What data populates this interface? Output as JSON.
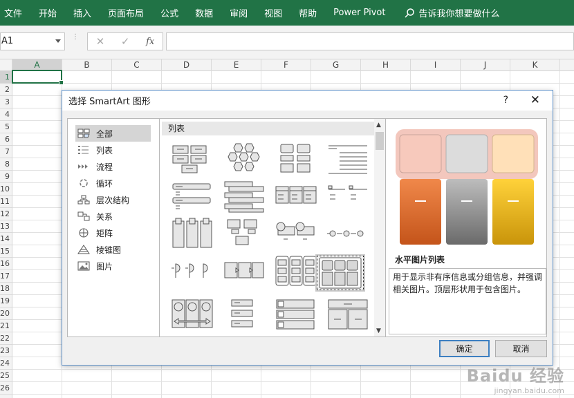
{
  "ribbon": {
    "tabs": [
      "文件",
      "开始",
      "插入",
      "页面布局",
      "公式",
      "数据",
      "审阅",
      "视图",
      "帮助",
      "Power Pivot"
    ],
    "tellme": "告诉我你想要做什么",
    "color": "#217346"
  },
  "formula_bar": {
    "name_box": "A1",
    "fx": "fx"
  },
  "grid": {
    "columns": [
      "A",
      "B",
      "C",
      "D",
      "E",
      "F",
      "G",
      "H",
      "I",
      "J",
      "K"
    ],
    "rows": [
      "1",
      "2",
      "3",
      "4",
      "5",
      "6",
      "7",
      "8",
      "9",
      "10",
      "11",
      "12",
      "13",
      "14",
      "15",
      "16",
      "17",
      "18",
      "19",
      "20",
      "21",
      "22",
      "23",
      "24",
      "25",
      "26"
    ],
    "selected_cell": "A1"
  },
  "dialog": {
    "title": "选择 SmartArt 图形",
    "help": "?",
    "close": "✕",
    "categories": [
      {
        "label": "全部",
        "icon": "all-icon"
      },
      {
        "label": "列表",
        "icon": "list-icon"
      },
      {
        "label": "流程",
        "icon": "process-icon"
      },
      {
        "label": "循环",
        "icon": "cycle-icon"
      },
      {
        "label": "层次结构",
        "icon": "hierarchy-icon"
      },
      {
        "label": "关系",
        "icon": "relationship-icon"
      },
      {
        "label": "矩阵",
        "icon": "matrix-icon"
      },
      {
        "label": "棱锥图",
        "icon": "pyramid-icon"
      },
      {
        "label": "图片",
        "icon": "picture-icon"
      }
    ],
    "selected_category": "全部",
    "gallery_header": "列表",
    "selected_layout": "水平图片列表",
    "preview_title": "水平图片列表",
    "preview_description": "用于显示非有序信息或分组信息，并强调相关图片。顶层形状用于包含图片。",
    "ok": "确定",
    "cancel": "取消"
  },
  "watermark": {
    "brand": "Baidu 经验",
    "url": "jingyan.baidu.com"
  }
}
